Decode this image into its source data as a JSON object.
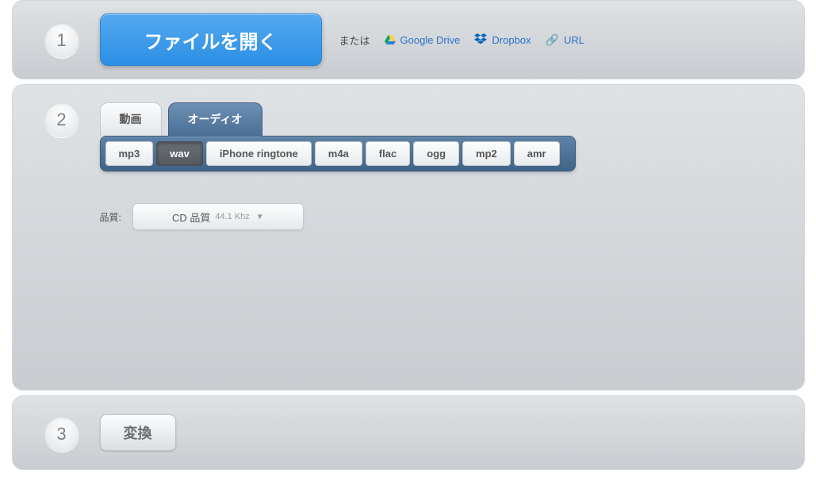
{
  "steps": {
    "one": "1",
    "two": "2",
    "three": "3"
  },
  "step1": {
    "open_label": "ファイルを開く",
    "or_label": "または",
    "gdrive": "Google Drive",
    "dropbox": "Dropbox",
    "url": "URL"
  },
  "step2": {
    "tabs": {
      "video": "動画",
      "audio": "オーディオ"
    },
    "formats": {
      "mp3": "mp3",
      "wav": "wav",
      "iphone": "iPhone ringtone",
      "m4a": "m4a",
      "flac": "flac",
      "ogg": "ogg",
      "mp2": "mp2",
      "amr": "amr"
    },
    "quality_label": "品質:",
    "quality_value": "CD 品質",
    "quality_sub": "44.1 Khz"
  },
  "step3": {
    "convert_label": "変換"
  }
}
